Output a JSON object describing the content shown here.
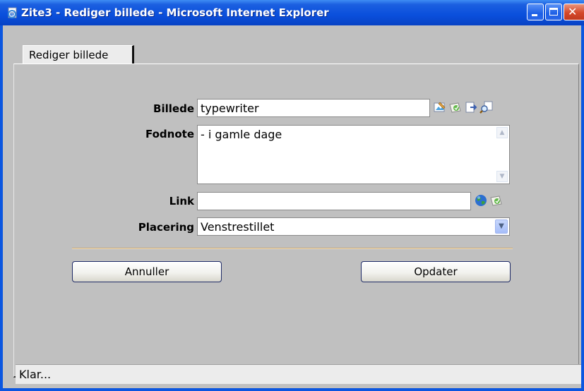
{
  "window": {
    "title": "Zite3 - Rediger billede - Microsoft Internet Explorer",
    "icon": "ie-page-icon"
  },
  "tab": {
    "label": "Rediger billede"
  },
  "form": {
    "billede_label": "Billede",
    "billede_value": "typewriter",
    "fodnote_label": "Fodnote",
    "fodnote_value": "- i gamle dage",
    "link_label": "Link",
    "link_value": "",
    "placering_label": "Placering",
    "placering_value": "Venstrestillet"
  },
  "buttons": {
    "cancel": "Annuller",
    "update": "Opdater"
  },
  "status": {
    "text": "Klar..."
  },
  "colors": {
    "titlebar": "#0a4fdc",
    "client": "#c0c0c0",
    "accent_divider": "#c8a878"
  }
}
